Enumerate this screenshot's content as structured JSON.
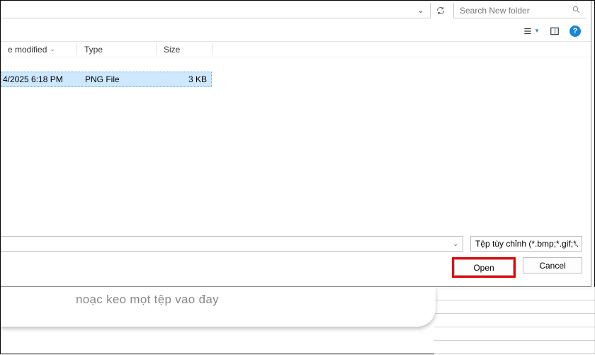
{
  "search": {
    "placeholder": "Search New folder"
  },
  "columns": {
    "dateModified": "e modified",
    "type": "Type",
    "size": "Size"
  },
  "file": {
    "date": "4/2025 6:18 PM",
    "type": "PNG File",
    "size": "3 KB"
  },
  "filter": {
    "label": "Tệp tùy chỉnh (*.bmp;*.gif;*.hei"
  },
  "buttons": {
    "open": "Open",
    "cancel": "Cancel"
  },
  "behind": {
    "hint": "noạc keo mọt tệp vao đay"
  }
}
